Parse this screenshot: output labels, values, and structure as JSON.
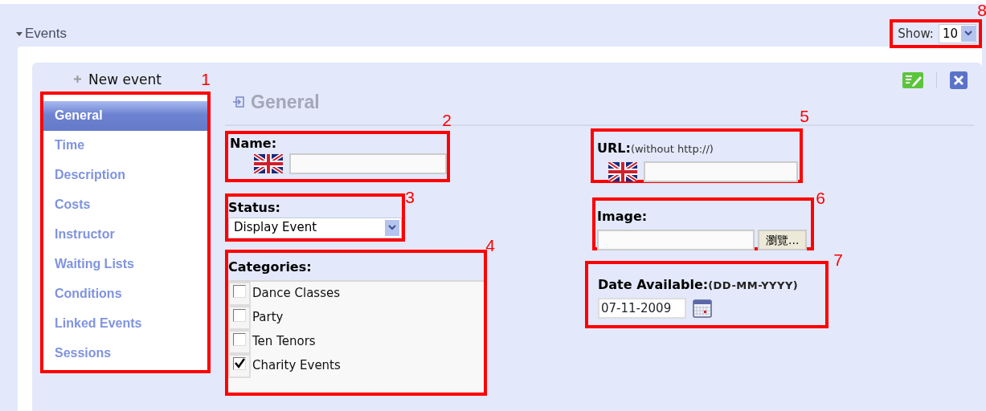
{
  "section": {
    "title": "Events",
    "expanded": true
  },
  "show": {
    "label": "Show:",
    "value": "10",
    "callout": "8"
  },
  "new_event": "New event",
  "sidebar": {
    "callout": "1",
    "items": [
      {
        "label": "General",
        "selected": true
      },
      {
        "label": "Time",
        "selected": false
      },
      {
        "label": "Description",
        "selected": false
      },
      {
        "label": "Costs",
        "selected": false
      },
      {
        "label": "Instructor",
        "selected": false
      },
      {
        "label": "Waiting Lists",
        "selected": false
      },
      {
        "label": "Conditions",
        "selected": false
      },
      {
        "label": "Linked Events",
        "selected": false
      },
      {
        "label": "Sessions",
        "selected": false
      }
    ]
  },
  "heading": "General",
  "name": {
    "label": "Name:",
    "callout": "2"
  },
  "status": {
    "label": "Status:",
    "value": "Display Event",
    "callout": "3"
  },
  "categories": {
    "label": "Categories:",
    "callout": "4",
    "items": [
      {
        "label": "Dance Classes",
        "checked": false
      },
      {
        "label": "Party",
        "checked": false
      },
      {
        "label": "Ten Tenors",
        "checked": false
      },
      {
        "label": "Charity Events",
        "checked": true
      }
    ]
  },
  "url": {
    "label": "URL:",
    "hint": "(without http://)",
    "callout": "5"
  },
  "image": {
    "label": "Image:",
    "button": "瀏覽...",
    "callout": "6"
  },
  "date": {
    "label": "Date Available:",
    "hint": "(DD-MM-YYYY)",
    "value": "07-11-2009",
    "callout": "7"
  }
}
